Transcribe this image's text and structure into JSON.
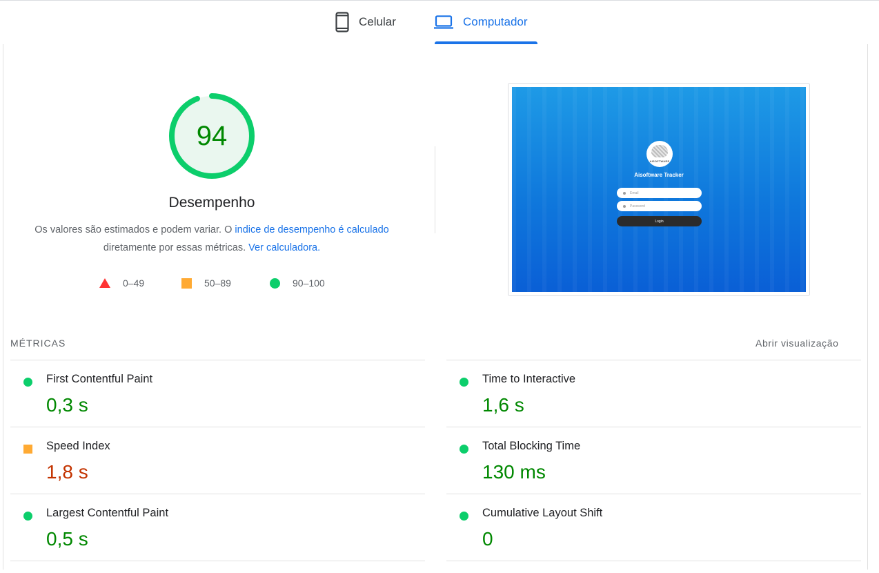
{
  "tabs": [
    {
      "label": "Celular",
      "icon": "smartphone-icon",
      "active": false
    },
    {
      "label": "Computador",
      "icon": "laptop-icon",
      "active": true
    }
  ],
  "score": {
    "value": 94,
    "fraction": 0.94,
    "title": "Desempenho",
    "color": "#0cce6b",
    "fill_color": "#eaf7ef",
    "text_color": "#008800"
  },
  "description": {
    "text1": "Os valores são estimados e podem variar. O ",
    "link1": "indice de desempenho é calculado",
    "text2": " diretamente por essas métricas. ",
    "link2": "Ver calculadora."
  },
  "legend": [
    {
      "range": "0–49",
      "shape": "triangle",
      "color": "#ff3333"
    },
    {
      "range": "50–89",
      "shape": "square",
      "color": "#ffaa33"
    },
    {
      "range": "90–100",
      "shape": "circle",
      "color": "#0cce6b"
    }
  ],
  "screenshot": {
    "app_title": "Aisoftware Tracker",
    "logo_text": "AISOFTWARE",
    "email_placeholder": "Email",
    "password_placeholder": "Password",
    "login_button": "Login"
  },
  "metrics": {
    "heading": "MÉTRICAS",
    "toggle_label": "Abrir visualização",
    "left": [
      {
        "name": "First Contentful Paint",
        "value": "0,3 s",
        "status": "pass"
      },
      {
        "name": "Speed Index",
        "value": "1,8 s",
        "status": "average"
      },
      {
        "name": "Largest Contentful Paint",
        "value": "0,5 s",
        "status": "pass"
      }
    ],
    "right": [
      {
        "name": "Time to Interactive",
        "value": "1,6 s",
        "status": "pass"
      },
      {
        "name": "Total Blocking Time",
        "value": "130 ms",
        "status": "pass"
      },
      {
        "name": "Cumulative Layout Shift",
        "value": "0",
        "status": "pass"
      }
    ]
  },
  "colors": {
    "pass": "#0cce6b",
    "average": "#ffaa33",
    "fail": "#ff3333",
    "pass_text": "#008800",
    "average_text": "#c33300",
    "link": "#1a73e8"
  }
}
